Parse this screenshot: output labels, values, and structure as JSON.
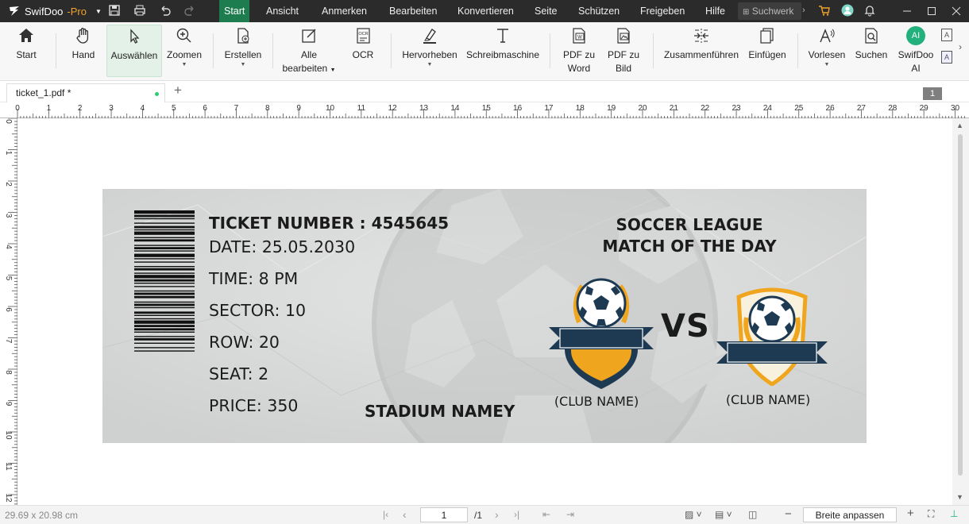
{
  "app": {
    "name": "SwifDoo",
    "edition": "-Pro"
  },
  "menu": {
    "items": [
      {
        "label": "Start",
        "active": true
      },
      {
        "label": "Ansicht"
      },
      {
        "label": "Anmerken"
      },
      {
        "label": "Bearbeiten"
      },
      {
        "label": "Konvertieren"
      },
      {
        "label": "Seite"
      },
      {
        "label": "Schützen"
      },
      {
        "label": "Freigeben"
      },
      {
        "label": "Hilfe"
      }
    ],
    "search_placeholder": "Suchwerk"
  },
  "ribbon": {
    "buttons": [
      {
        "line1": "Start",
        "icon": "home-icon"
      },
      {
        "line1": "Hand",
        "icon": "hand-icon"
      },
      {
        "line1": "Auswählen",
        "icon": "cursor-icon",
        "selected": true
      },
      {
        "line1": "Zoomen",
        "icon": "zoom-icon",
        "dropdown": true
      },
      {
        "line1": "Erstellen",
        "icon": "create-icon",
        "dropdown": true
      },
      {
        "line1": "Alle",
        "line2": "bearbeiten",
        "icon": "edit-all-icon",
        "dropdown": true
      },
      {
        "line1": "OCR",
        "icon": "ocr-icon"
      },
      {
        "line1": "Hervorheben",
        "icon": "highlight-icon",
        "dropdown": true
      },
      {
        "line1": "Schreibmaschine",
        "icon": "typewriter-icon"
      },
      {
        "line1": "PDF zu",
        "line2": "Word",
        "icon": "pdf-to-word-icon"
      },
      {
        "line1": "PDF zu",
        "line2": "Bild",
        "icon": "pdf-to-image-icon"
      },
      {
        "line1": "Zusammenführen",
        "icon": "merge-icon"
      },
      {
        "line1": "Einfügen",
        "icon": "insert-icon"
      },
      {
        "line1": "Vorlesen",
        "icon": "read-aloud-icon",
        "dropdown": true
      },
      {
        "line1": "Suchen",
        "icon": "search-doc-icon"
      },
      {
        "line1": "SwifDoo",
        "line2": "AI",
        "icon": "ai-icon"
      }
    ],
    "ai_badge": "AI"
  },
  "tabs": {
    "document": "ticket_1.pdf *",
    "add": "+",
    "page_badge": "1"
  },
  "ruler": {
    "h_labels": [
      "0",
      "1",
      "2",
      "3",
      "4",
      "5",
      "6",
      "7",
      "8",
      "9",
      "10",
      "11",
      "12",
      "13",
      "14",
      "15",
      "16",
      "17",
      "18",
      "19",
      "20",
      "21",
      "22",
      "23",
      "24",
      "25",
      "26",
      "27",
      "28",
      "29",
      "30"
    ],
    "v_labels": [
      "0",
      "1",
      "2",
      "3",
      "4",
      "5",
      "6",
      "7",
      "8",
      "9",
      "10",
      "11",
      "12"
    ]
  },
  "ticket": {
    "number": "TICKET NUMBER : 4545645",
    "date": "DATE: 25.05.2030",
    "time": "TIME: 8 PM",
    "sector": "SECTOR: 10",
    "row": "ROW: 20",
    "seat": "SEAT: 2",
    "price": "PRICE: 350",
    "league_line1": "SOCCER LEAGUE",
    "league_line2": "MATCH OF THE DAY",
    "vs": "VS",
    "club1": "(CLUB NAME)",
    "club2": "(CLUB NAME)",
    "stadium": "STADIUM NAMEY"
  },
  "status": {
    "dimensions": "29.69 x 20.98 cm",
    "page_input": "1",
    "page_total": "/1",
    "zoom_mode": "Breite anpassen"
  },
  "colors": {
    "accent": "#1e7d4e",
    "titlebar": "#2b2b2b",
    "navy": "#1d3a52",
    "gold": "#f0a51e",
    "ticket_bg": "#d7d8d8"
  }
}
